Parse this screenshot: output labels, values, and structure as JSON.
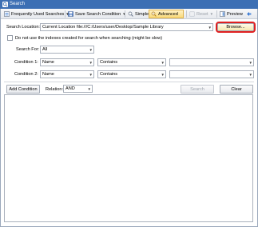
{
  "window": {
    "title": "Search"
  },
  "toolbar": {
    "frequent_label": "Frequently Used Searches",
    "save_label": "Save Search Condition",
    "simple_label": "Simple",
    "advanced_label": "Advanced",
    "reset_label": "Reset",
    "preview_label": "Preview"
  },
  "form": {
    "search_location_label": "Search Location:",
    "search_location_value": "Current Location file:///C:/Users/user/Desktop/Sample Library",
    "browse_label": "Browse...",
    "no_index_label": "Do not use the indexes created for search when searching (might be slow)",
    "search_for_label": "Search For:",
    "search_for_value": "All",
    "condition1_label": "Condition 1:",
    "condition1_field": "Name",
    "condition1_op": "Contains",
    "condition1_value": "",
    "condition2_label": "Condition 2:",
    "condition2_field": "Name",
    "condition2_op": "Contains",
    "condition2_value": "",
    "add_condition_label": "Add Condition",
    "relation_label": "Relation:",
    "relation_value": "AND",
    "search_label": "Search",
    "clear_label": "Clear"
  },
  "colors": {
    "titlebar": "#3c6fb4",
    "active_tab": "#f9d97a",
    "highlight": "#e02020"
  }
}
